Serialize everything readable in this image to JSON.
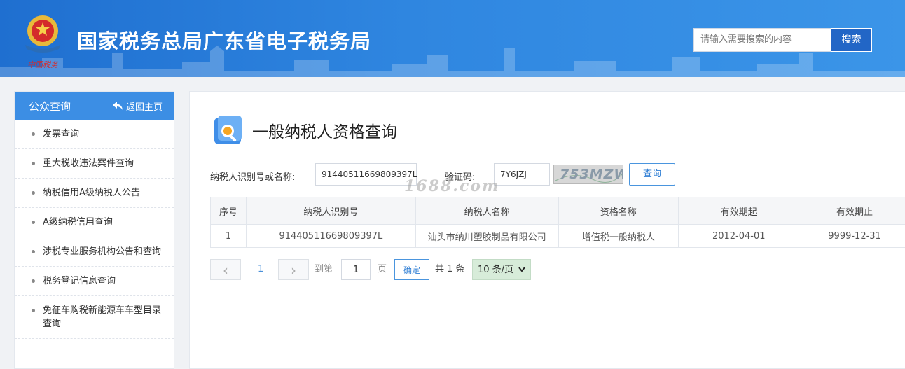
{
  "header": {
    "site_title": "国家税务总局广东省电子税务局",
    "emblem_caption": "中国税务",
    "search_placeholder": "请输入需要搜索的内容",
    "search_button": "搜索"
  },
  "sidebar": {
    "title": "公众查询",
    "back_label": "返回主页",
    "items": [
      {
        "label": "发票查询"
      },
      {
        "label": "重大税收违法案件查询"
      },
      {
        "label": "纳税信用A级纳税人公告"
      },
      {
        "label": "A级纳税信用查询"
      },
      {
        "label": "涉税专业服务机构公告和查询"
      },
      {
        "label": "税务登记信息查询"
      },
      {
        "label": "免征车购税新能源车车型目录查询"
      }
    ]
  },
  "main": {
    "title": "一般纳税人资格查询",
    "form": {
      "taxpayer_label": "纳税人识别号或名称:",
      "taxpayer_value": "91440511669809397L",
      "captcha_label": "验证码:",
      "captcha_value": "7Y6JZJ",
      "captcha_image_text": "753MZW",
      "query_button": "查询"
    },
    "watermark": "1688.com",
    "table": {
      "headers": [
        "序号",
        "纳税人识别号",
        "纳税人名称",
        "资格名称",
        "有效期起",
        "有效期止"
      ],
      "rows": [
        [
          "1",
          "91440511669809397L",
          "汕头市纳川塑胶制品有限公司",
          "增值税一般纳税人",
          "2012-04-01",
          "9999-12-31"
        ]
      ]
    },
    "pager": {
      "prev": "‹",
      "current_page": "1",
      "next": "›",
      "goto_label": "到第",
      "goto_value": "1",
      "page_unit": "页",
      "confirm": "确定",
      "total": "共 1 条",
      "page_size": "10 条/页"
    }
  },
  "colors": {
    "header_blue": "#2f86e0",
    "sidebar_head": "#3c8ee4",
    "search_button": "#2266c6",
    "link_blue": "#2e7ed4"
  }
}
